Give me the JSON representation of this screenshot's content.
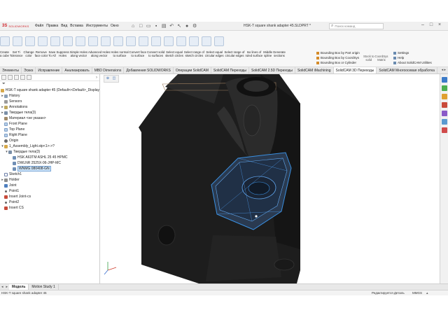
{
  "app": {
    "logo_mark": "3S",
    "logo_text": "SOLIDWORKS",
    "document_title": "HSK-T square shank adapter 45.SLDPRT *",
    "search_placeholder": "Поиск команд",
    "menus": [
      "Файл",
      "Правка",
      "Вид",
      "Вставка",
      "Инструменты",
      "Окно"
    ],
    "quick_access_icons": [
      "home-icon",
      "new-icon",
      "open-icon",
      "save-icon",
      "print-icon",
      "undo-icon",
      "select-icon",
      "rebuild-icon",
      "options-icon"
    ],
    "window_controls": [
      "minimize-icon",
      "restore-icon",
      "close-icon"
    ]
  },
  "ribbon": {
    "tools": [
      {
        "line1": "Create",
        "line2": "a cube"
      },
      {
        "line1": "Set Ti",
        "line2": "Tolerance"
      },
      {
        "line1": "Change",
        "line2": "color"
      },
      {
        "line1": "Remove",
        "line2": "face color"
      },
      {
        "line1": "Save",
        "line2": "To All"
      },
      {
        "line1": "Suppress",
        "line2": "Holes"
      },
      {
        "line1": "Simple Holes",
        "line2": "along vector"
      },
      {
        "line1": "Advanced Holes",
        "line2": "along vector"
      },
      {
        "line1": "Holes normal",
        "line2": "to surface"
      },
      {
        "line1": "Convert face",
        "line2": "to surface"
      },
      {
        "line1": "Convert solid",
        "line2": "to surfaces"
      },
      {
        "line1": "Select equal",
        "line2": "sketch circles"
      },
      {
        "line1": "Select range of",
        "line2": "sketch circles"
      },
      {
        "line1": "Select equal",
        "line2": "circular edges"
      },
      {
        "line1": "Select range of",
        "line2": "circular edges"
      },
      {
        "line1": "Iso lines of",
        "line2": "ruled surface"
      },
      {
        "line1": "Middle",
        "line2": "spline"
      },
      {
        "line1": "Generate",
        "line2": "sections"
      }
    ],
    "bounding_box_items": [
      "Bounding Box by Part origin",
      "Bounding Box by CoordSys",
      "Bounding Box or Cylinder"
    ],
    "right_tools": [
      {
        "line1": "Stock to",
        "line2": "solid"
      },
      {
        "line1": "CoordSys",
        "line2": "Matrix"
      }
    ],
    "settings_items": [
      "Settings",
      "Help",
      "About SolidCAM Utilities"
    ]
  },
  "command_tabs": [
    {
      "label": "Элементы",
      "active": false
    },
    {
      "label": "Эскиз",
      "active": false
    },
    {
      "label": "Исправление",
      "active": false
    },
    {
      "label": "Анализировать",
      "active": false
    },
    {
      "label": "MBD Dimensions",
      "active": false
    },
    {
      "label": "Добавления SOLIDWORKS",
      "active": false
    },
    {
      "label": "Операции SolidCAM",
      "active": false
    },
    {
      "label": "SolidCAM Переходы",
      "active": false
    },
    {
      "label": "SolidCAM 2.5D Переходы",
      "active": false
    },
    {
      "label": "SolidCAM iMachining",
      "active": false
    },
    {
      "label": "SolidCAM 3D Переходы",
      "active": true
    },
    {
      "label": "SolidCAM Многоосевая обработка",
      "active": false
    }
  ],
  "feature_tree": {
    "root": "HSK-T square shank adapter 45 (Default<<Default>_Display",
    "items": [
      {
        "label": "History",
        "icon": "history-icon",
        "indent": 1,
        "expander": "▸"
      },
      {
        "label": "Sensors",
        "icon": "sensors-icon",
        "indent": 1,
        "expander": ""
      },
      {
        "label": "Annotations",
        "icon": "annotations-icon",
        "indent": 1,
        "expander": "▸"
      },
      {
        "label": "Твердые тела(3)",
        "icon": "solid-bodies-icon",
        "indent": 1,
        "expander": "▸"
      },
      {
        "label": "Материал <не указан>",
        "icon": "material-icon",
        "indent": 1,
        "expander": ""
      },
      {
        "label": "Front Plane",
        "icon": "plane-icon",
        "indent": 1,
        "expander": ""
      },
      {
        "label": "Top Plane",
        "icon": "plane-icon",
        "indent": 1,
        "expander": ""
      },
      {
        "label": "Right Plane",
        "icon": "plane-icon",
        "indent": 1,
        "expander": ""
      },
      {
        "label": "Origin",
        "icon": "origin-icon",
        "indent": 1,
        "expander": ""
      },
      {
        "label": "1_Assembly_Light.stp<1>->?",
        "icon": "assembly-icon",
        "indent": 1,
        "expander": "▾"
      },
      {
        "label": "Твердые тела(3)",
        "icon": "solid-bodies-icon",
        "indent": 2,
        "expander": "▾"
      },
      {
        "label": "HSK A63TM ASHL 25 45 HPMC",
        "icon": "solid-icon",
        "indent": 3,
        "expander": ""
      },
      {
        "label": "DWLNR 2525X-06-JHP-MC",
        "icon": "solid-icon",
        "indent": 3,
        "expander": ""
      },
      {
        "label": "WNMG 080408-GN",
        "icon": "solid-icon",
        "indent": 3,
        "expander": "",
        "selected": true
      },
      {
        "label": "Sketch1",
        "icon": "sketch-icon",
        "indent": 1,
        "expander": ""
      },
      {
        "label": "Holder",
        "icon": "holder-icon",
        "indent": 1,
        "expander": "▸"
      },
      {
        "label": "Joint",
        "icon": "joint-icon",
        "indent": 1,
        "expander": ""
      },
      {
        "label": "Point1",
        "icon": "point-icon",
        "indent": 1,
        "expander": ""
      },
      {
        "label": "Insert Joint-cs",
        "icon": "csys-icon",
        "indent": 1,
        "expander": ""
      },
      {
        "label": "Point2",
        "icon": "point-icon",
        "indent": 1,
        "expander": ""
      },
      {
        "label": "Insert CS",
        "icon": "csys-icon",
        "indent": 1,
        "expander": ""
      }
    ]
  },
  "bottom_tabs": [
    {
      "label": "Модель",
      "active": true
    },
    {
      "label": "Motion Study 1",
      "active": false
    }
  ],
  "status": {
    "file": "HSK-T square shank adapter 45",
    "mode": "Редактируется Деталь",
    "units": "MMGS"
  },
  "colors": {
    "model_body": "#1c1c1c",
    "selection": "#3a8fe0",
    "accent_red": "#d0242b"
  }
}
